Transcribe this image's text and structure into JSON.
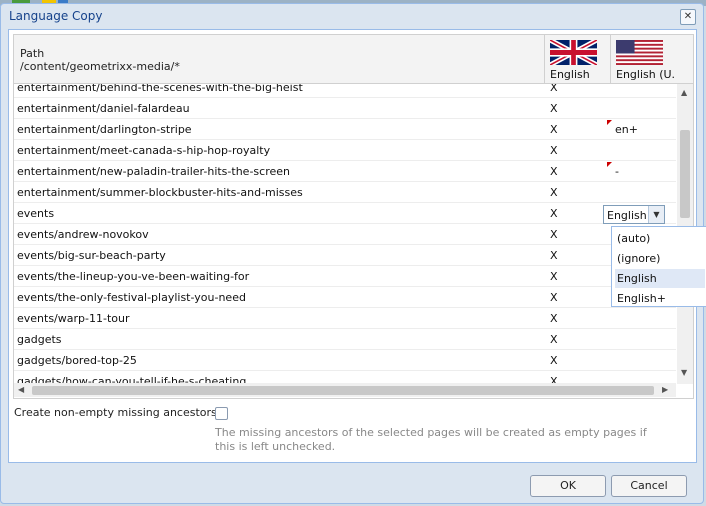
{
  "dialog": {
    "title": "Language Copy",
    "close_icon": "close-icon"
  },
  "grid": {
    "header": {
      "path_label": "Path",
      "path_value": "/content/geometrixx-media/*",
      "col1_label": "English",
      "col1_flag": "uk-flag-icon",
      "col2_label": "English (U...",
      "col2_flag": "us-flag-icon"
    },
    "rows": [
      {
        "path": "entertainment/behind-the-scenes-with-the-big-heist",
        "col1": "X",
        "col2": ""
      },
      {
        "path": "entertainment/daniel-falardeau",
        "col1": "X",
        "col2": ""
      },
      {
        "path": "entertainment/darlington-stripe",
        "col1": "X",
        "col2": "en+"
      },
      {
        "path": "entertainment/meet-canada-s-hip-hop-royalty",
        "col1": "X",
        "col2": ""
      },
      {
        "path": "entertainment/new-paladin-trailer-hits-the-screen",
        "col1": "X",
        "col2": "-"
      },
      {
        "path": "entertainment/summer-blockbuster-hits-and-misses",
        "col1": "X",
        "col2": ""
      },
      {
        "path": "events",
        "col1": "X",
        "col2": ""
      },
      {
        "path": "events/andrew-novokov",
        "col1": "X",
        "col2": ""
      },
      {
        "path": "events/big-sur-beach-party",
        "col1": "X",
        "col2": ""
      },
      {
        "path": "events/the-lineup-you-ve-been-waiting-for",
        "col1": "X",
        "col2": ""
      },
      {
        "path": "events/the-only-festival-playlist-you-need",
        "col1": "X",
        "col2": ""
      },
      {
        "path": "events/warp-11-tour",
        "col1": "X",
        "col2": ""
      },
      {
        "path": "gadgets",
        "col1": "X",
        "col2": ""
      },
      {
        "path": "gadgets/bored-top-25",
        "col1": "X",
        "col2": ""
      },
      {
        "path": "gadgets/how-can-you-tell-if-he-s-cheating",
        "col1": "X",
        "col2": ""
      }
    ]
  },
  "combo": {
    "value": "English",
    "options": [
      "(auto)",
      "(ignore)",
      "English",
      "English+"
    ],
    "selected": "English"
  },
  "options": {
    "create_ancestors_label": "Create non-empty missing ancestors",
    "create_ancestors_checked": false,
    "help_text": "The missing ancestors of the selected pages will be created as empty pages if this is left unchecked."
  },
  "buttons": {
    "ok": "OK",
    "cancel": "Cancel"
  },
  "colors": {
    "title": "#15428b",
    "panel_border": "#99bbe8",
    "dirty_marker": "#cc0000"
  }
}
